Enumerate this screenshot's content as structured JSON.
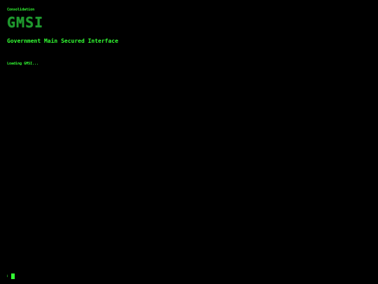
{
  "header": {
    "context_label": "Consolidation",
    "logo_text": "GMSI",
    "subtitle": "Government Main Secured Interface"
  },
  "console": {
    "status": "Loading GMSI...",
    "prompt_symbol": ":"
  },
  "colors": {
    "background": "#000000",
    "text": "#33ff33",
    "logo": "#1f9a2e"
  }
}
